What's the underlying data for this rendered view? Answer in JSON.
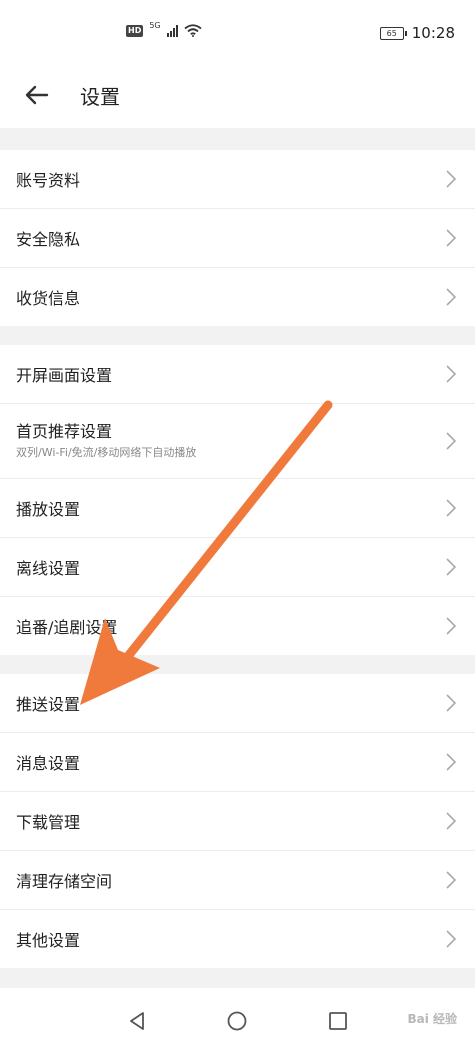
{
  "status_bar": {
    "hd": "HD",
    "network": "5G",
    "battery": "65",
    "time": "10:28"
  },
  "header": {
    "title": "设置"
  },
  "groups": [
    {
      "items": [
        {
          "label": "账号资料"
        },
        {
          "label": "安全隐私"
        },
        {
          "label": "收货信息"
        }
      ]
    },
    {
      "items": [
        {
          "label": "开屏画面设置"
        },
        {
          "label": "首页推荐设置",
          "sub": "双列/Wi-Fi/免流/移动网络下自动播放"
        },
        {
          "label": "播放设置"
        },
        {
          "label": "离线设置"
        },
        {
          "label": "追番/追剧设置"
        }
      ]
    },
    {
      "items": [
        {
          "label": "推送设置"
        },
        {
          "label": "消息设置"
        },
        {
          "label": "下载管理"
        },
        {
          "label": "清理存储空间"
        },
        {
          "label": "其他设置"
        }
      ]
    }
  ],
  "overlay": {
    "arrow_color": "#f07a3c"
  },
  "watermark": "Bai 经验"
}
